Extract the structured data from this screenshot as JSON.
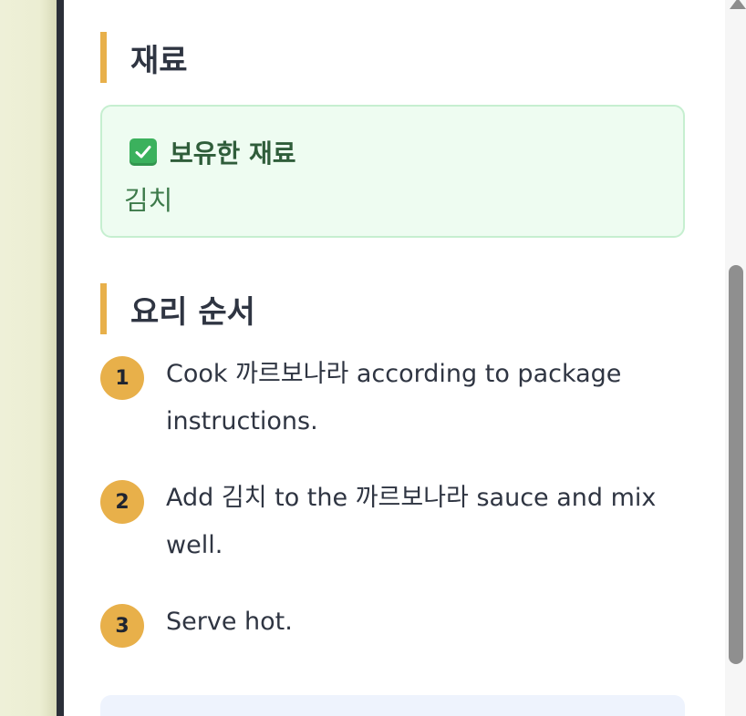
{
  "sections": {
    "ingredients_title": "재료",
    "steps_title": "요리 순서"
  },
  "owned": {
    "icon": "check-mark-button-icon",
    "header": "보유한 재료",
    "items": [
      "김치"
    ]
  },
  "steps": [
    {
      "num": "1",
      "text": "Cook 까르보나라 according to package instructions."
    },
    {
      "num": "2",
      "text": "Add 김치 to the 까르보나라 sauce and mix well."
    },
    {
      "num": "3",
      "text": "Serve hot."
    }
  ],
  "colors": {
    "accent": "#e8b04a",
    "owned_bg": "#eefcf1",
    "owned_border": "#c6efd0",
    "owned_text": "#2f5d3a",
    "text": "#2f3542",
    "sidebar_border": "#2b2f38"
  }
}
